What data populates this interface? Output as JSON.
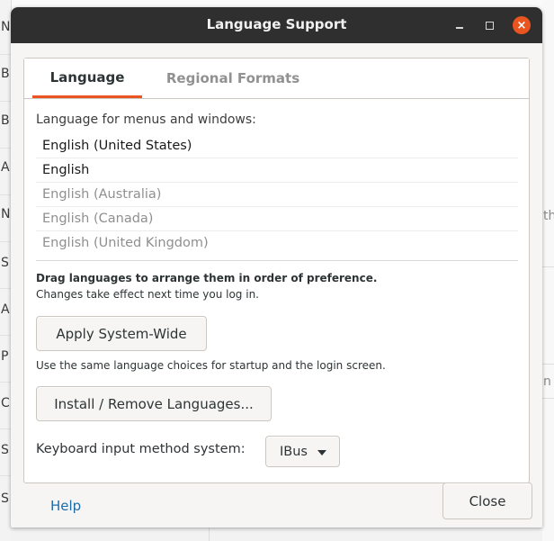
{
  "background_app": {
    "left_letters": [
      "N",
      "B",
      "B",
      "A",
      "N",
      "S",
      "A",
      "P",
      "C",
      "S",
      "S"
    ],
    "right_fragments": [
      "th",
      "n"
    ]
  },
  "window": {
    "title": "Language Support",
    "controls": {
      "minimize_icon": "minimize-icon",
      "maximize_icon": "maximize-icon",
      "close_icon": "close-icon",
      "close_glyph": "×"
    }
  },
  "tabs": [
    {
      "label": "Language",
      "active": true
    },
    {
      "label": "Regional Formats",
      "active": false
    }
  ],
  "language_tab": {
    "list_label": "Language for menus and windows:",
    "languages": [
      {
        "name": "English (United States)",
        "enabled": true
      },
      {
        "name": "English",
        "enabled": true
      },
      {
        "name": "English (Australia)",
        "enabled": false
      },
      {
        "name": "English (Canada)",
        "enabled": false
      },
      {
        "name": "English (United Kingdom)",
        "enabled": false
      }
    ],
    "drag_hint": "Drag languages to arrange them in order of preference.",
    "change_note": "Changes take effect next time you log in.",
    "apply_button": "Apply System-Wide",
    "apply_note": "Use the same language choices for startup and the login screen.",
    "install_button": "Install / Remove Languages...",
    "keyboard_label": "Keyboard input method system:",
    "keyboard_value": "IBus"
  },
  "footer": {
    "help_label": "Help",
    "close_label": "Close"
  },
  "colors": {
    "accent": "#e95420",
    "titlebar": "#2f2f2f",
    "link": "#1c6ca8"
  }
}
